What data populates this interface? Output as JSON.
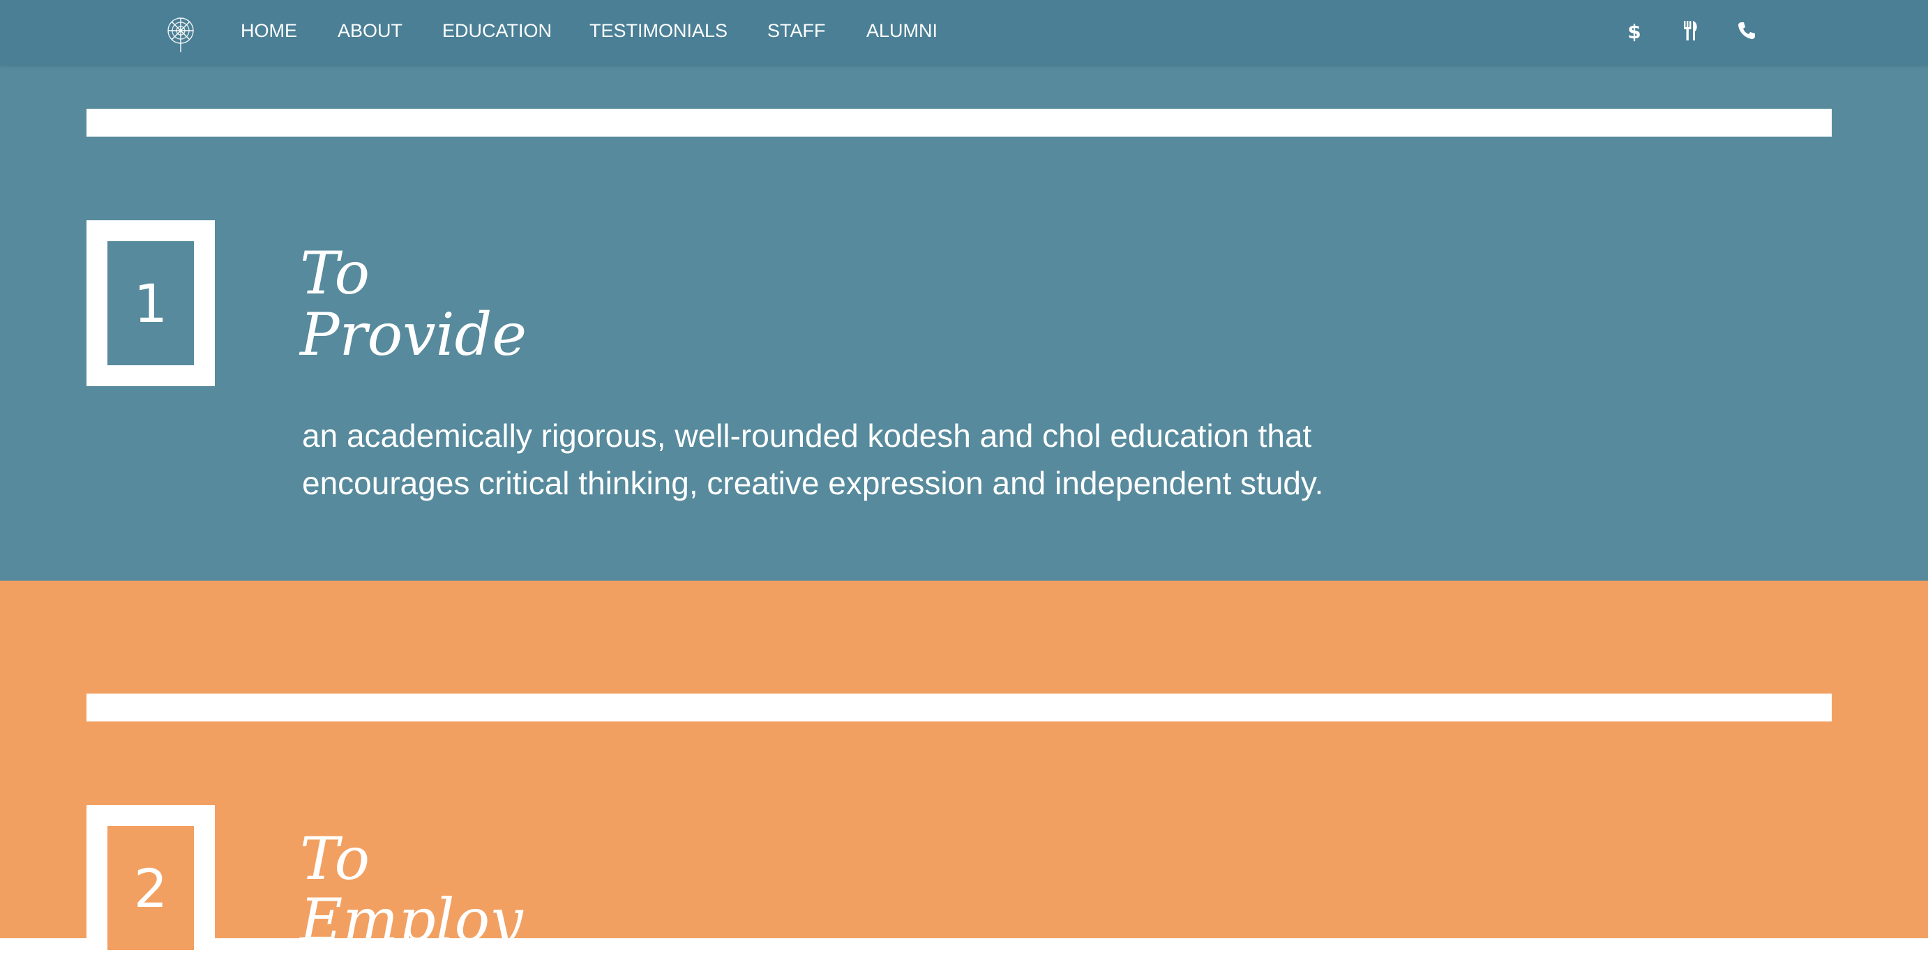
{
  "nav": {
    "items": [
      "HOME",
      "ABOUT",
      "EDUCATION",
      "TESTIMONIALS",
      "STAFF",
      "ALUMNI"
    ],
    "icons": [
      "dollar-icon",
      "utensils-icon",
      "phone-icon"
    ],
    "logo": "dandelion-logo"
  },
  "sections": [
    {
      "number": "1",
      "heading_line1": "To",
      "heading_line2": "Provide",
      "text": "an academically rigorous, well-rounded kodesh and chol education that encourages critical thinking, creative expression and independent study.",
      "color": "#568a9c"
    },
    {
      "number": "2",
      "heading_line1": "To",
      "heading_line2": "Employ",
      "color": "#f2a061"
    }
  ],
  "colors": {
    "navbar": "#4a7f95",
    "blue_section": "#568a9c",
    "orange_section": "#f2a061",
    "white": "#ffffff"
  }
}
